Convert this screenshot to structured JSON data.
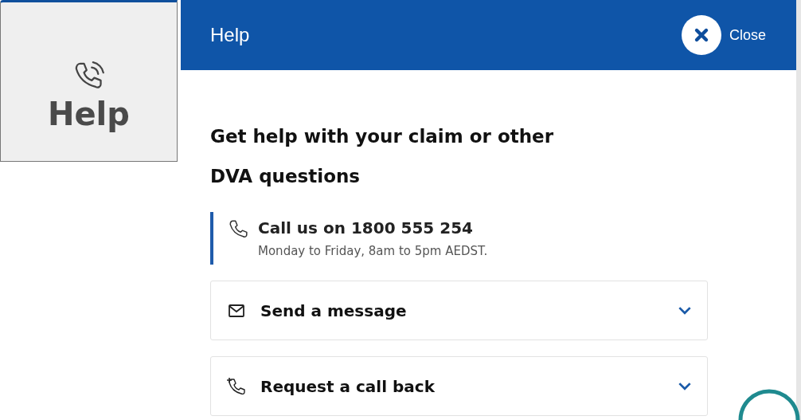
{
  "side_tab": {
    "label": "Help",
    "selected": true
  },
  "panel": {
    "title": "Help",
    "close_label": "Close"
  },
  "heading": "Get help with your claim or other DVA questions",
  "call": {
    "title": "Call us on 1800 555 254",
    "hours": "Monday to Friday, 8am to 5pm AEDST."
  },
  "accordions": [
    {
      "kind": "message",
      "label": "Send a message",
      "expanded": false
    },
    {
      "kind": "callback",
      "label": "Request a call back",
      "expanded": false
    }
  ]
}
